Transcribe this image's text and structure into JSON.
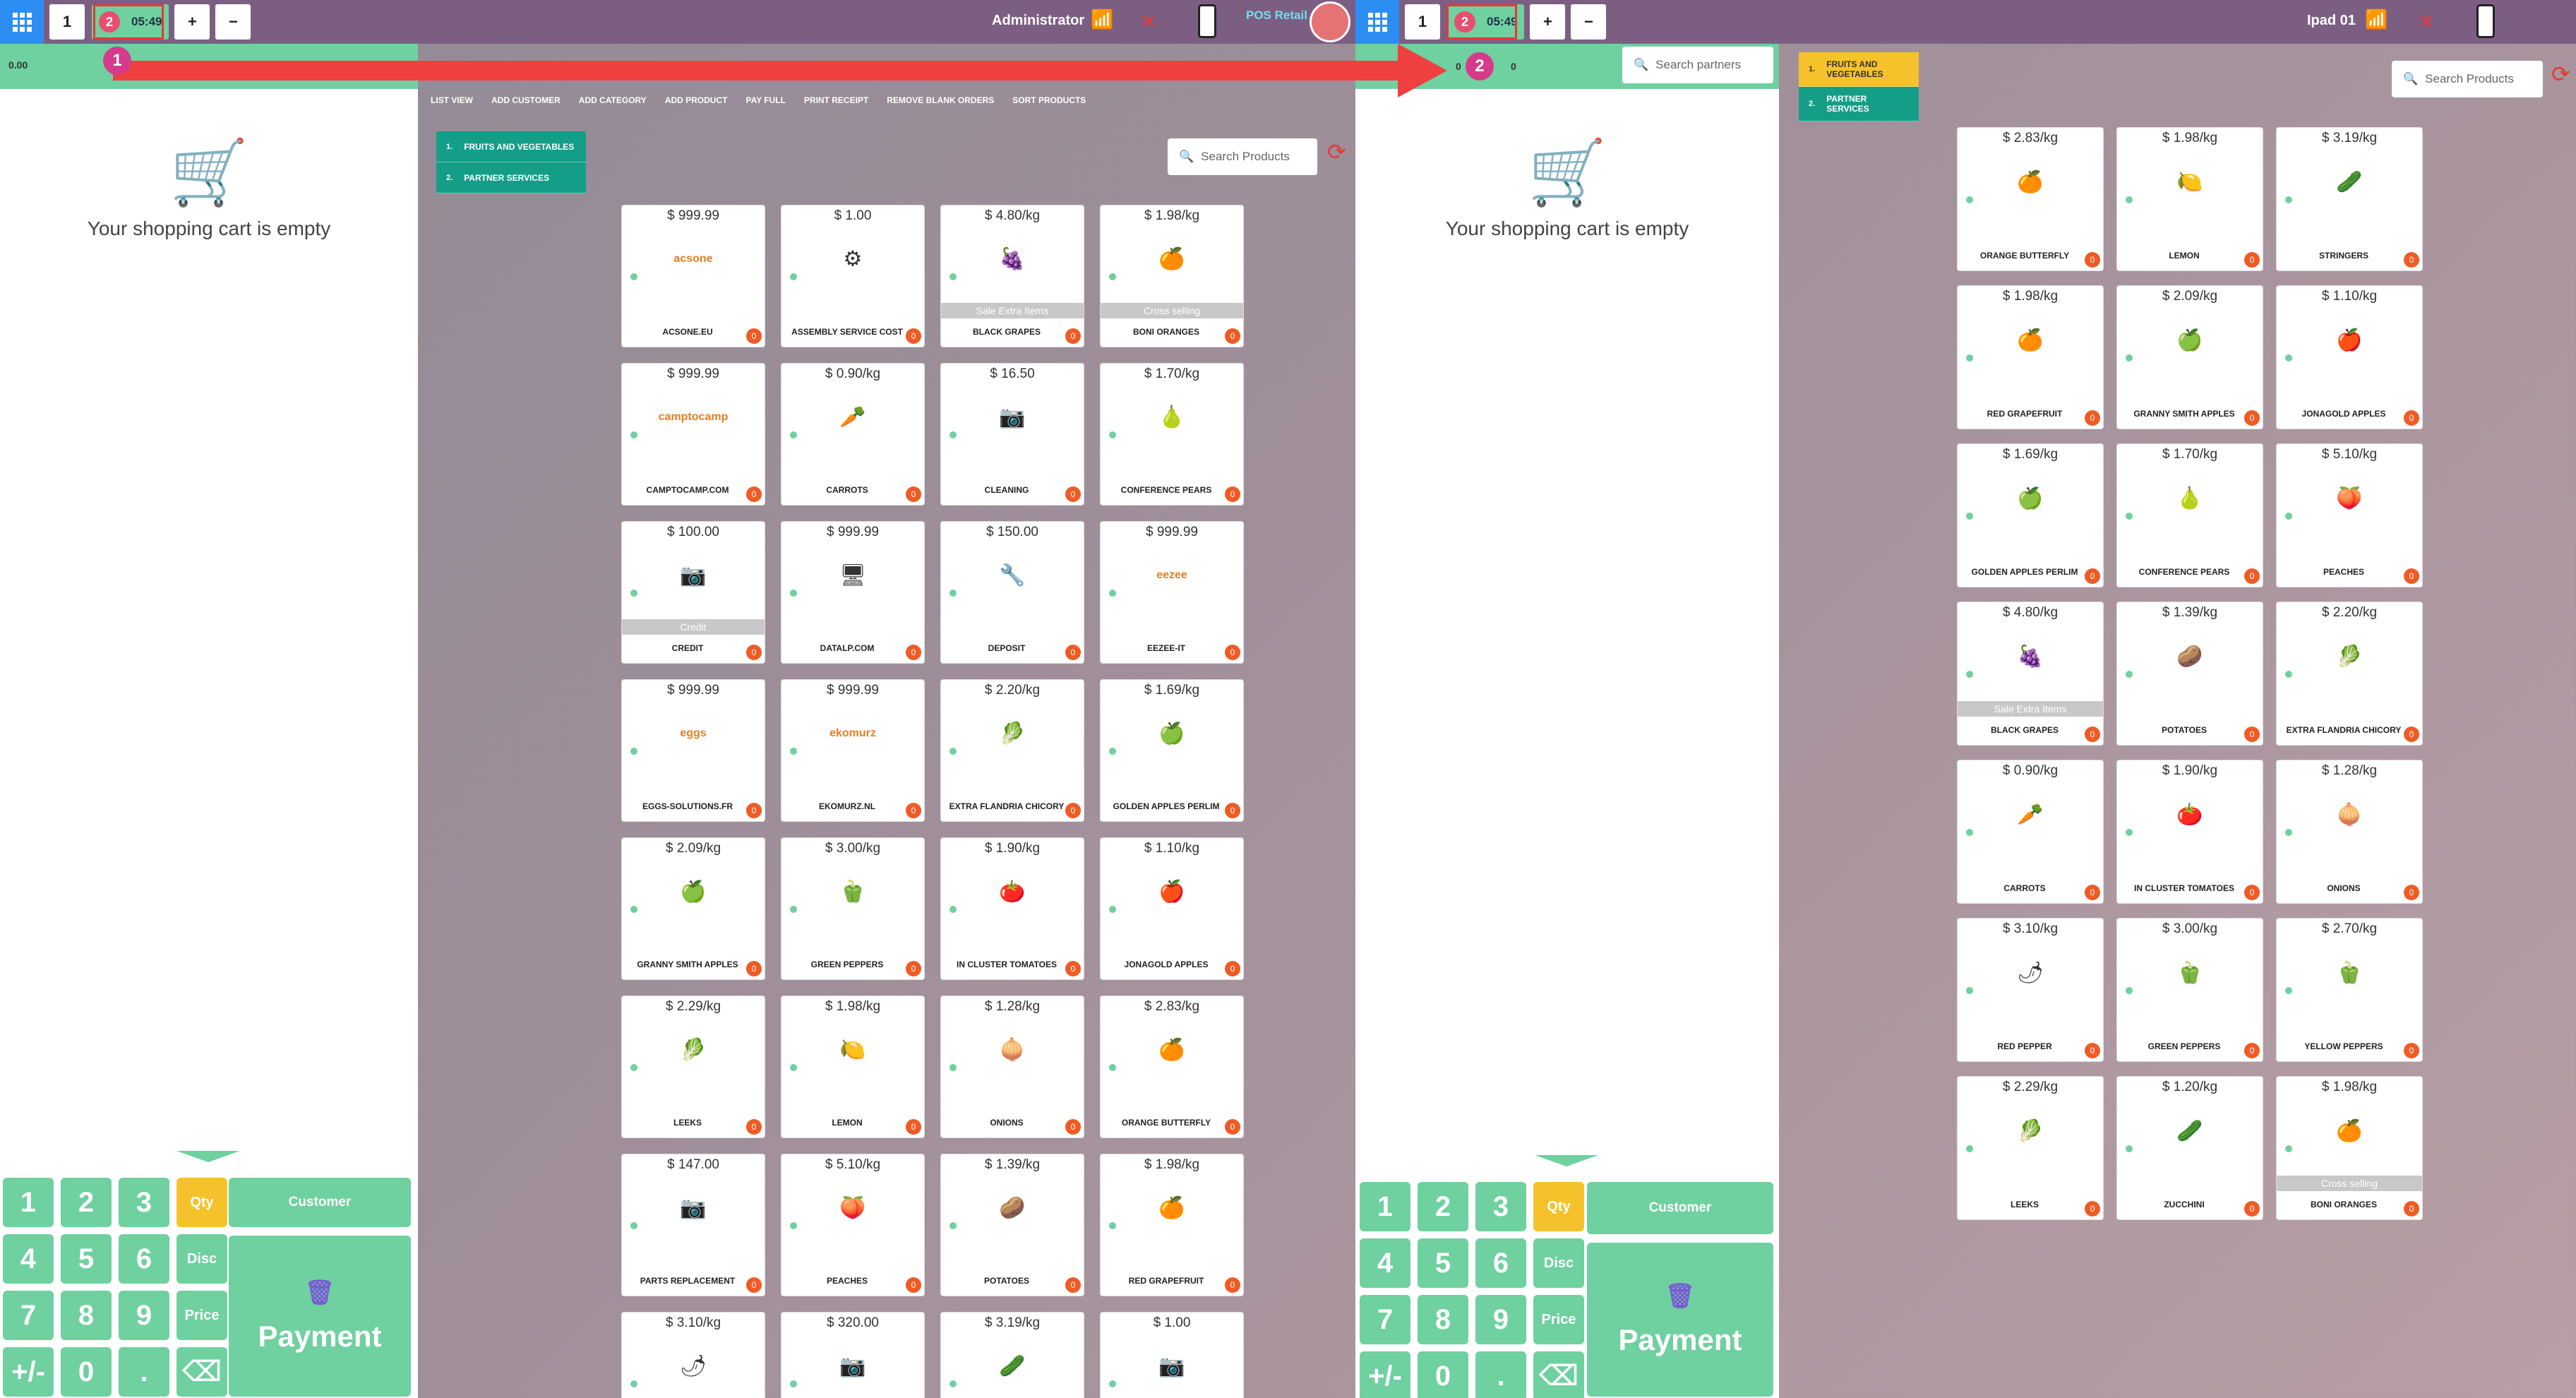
{
  "left_topbar": {
    "tab_number": "1",
    "order_number": "2",
    "order_time": "05:49",
    "plus_label": "+",
    "minus_label": "−",
    "user_label": "Administrator",
    "brand_label": "POS Retail"
  },
  "right_topbar": {
    "tab_number": "1",
    "order_number": "2",
    "order_time": "05:49",
    "plus_label": "+",
    "minus_label": "−",
    "device_label": "Ipad 01"
  },
  "left_panel": {
    "strip_value": "0.00",
    "cart_empty_text": "Your shopping cart is empty",
    "customer_label": "Customer",
    "payment_label": "Payment"
  },
  "right_panel": {
    "strip_value_a": "0",
    "strip_value_b": "0",
    "search_placeholder": "Search partners",
    "cart_empty_text": "Your shopping cart is empty",
    "customer_label": "Customer",
    "payment_label": "Payment"
  },
  "numpad_keys": [
    "1",
    "2",
    "3",
    "Qty",
    "4",
    "5",
    "6",
    "Disc",
    "7",
    "8",
    "9",
    "Price",
    "+/-",
    "0",
    ".",
    "⌫"
  ],
  "toolbar": [
    "LIST VIEW",
    "ADD CUSTOMER",
    "ADD CATEGORY",
    "ADD PRODUCT",
    "PAY FULL",
    "PRINT RECEIPT",
    "REMOVE BLANK ORDERS",
    "SORT PRODUCTS"
  ],
  "categories_left": [
    {
      "idx": "1.",
      "label": "FRUITS AND VEGETABLES"
    },
    {
      "idx": "2.",
      "label": "PARTNER SERVICES"
    }
  ],
  "categories_right": [
    {
      "idx": "1.",
      "label": "FRUITS AND VEGETABLES"
    },
    {
      "idx": "2.",
      "label": "PARTNER SERVICES"
    }
  ],
  "search_products_placeholder": "Search Products",
  "annotations": {
    "marker_1": "1",
    "marker_2": "2"
  },
  "products_left": [
    {
      "price": "$ 999.99",
      "name": "ACSONE.EU",
      "badge": "0",
      "thumb": "acsone"
    },
    {
      "price": "$ 1.00",
      "name": "ASSEMBLY SERVICE COST",
      "badge": "0",
      "thumb": "⚙"
    },
    {
      "price": "$ 4.80/kg",
      "name": "BLACK GRAPES",
      "badge": "0",
      "thumb": "🍇",
      "promo": "Sale Extra Items"
    },
    {
      "price": "$ 1.98/kg",
      "name": "BONI ORANGES",
      "badge": "0",
      "thumb": "🍊",
      "promo": "Cross selling"
    },
    {
      "price": "$ 999.99",
      "name": "CAMPTOCAMP.COM",
      "badge": "0",
      "thumb": "camptocamp"
    },
    {
      "price": "$ 0.90/kg",
      "name": "CARROTS",
      "badge": "0",
      "thumb": "🥕"
    },
    {
      "price": "$ 16.50",
      "name": "CLEANING",
      "badge": "0",
      "thumb": "📷"
    },
    {
      "price": "$ 1.70/kg",
      "name": "CONFERENCE PEARS",
      "badge": "0",
      "thumb": "🍐"
    },
    {
      "price": "$ 100.00",
      "name": "CREDIT",
      "badge": "0",
      "thumb": "📷",
      "promo": "Credit"
    },
    {
      "price": "$ 999.99",
      "name": "DATALP.COM",
      "badge": "0",
      "thumb": "🖥"
    },
    {
      "price": "$ 150.00",
      "name": "DEPOSIT",
      "badge": "0",
      "thumb": "🔧"
    },
    {
      "price": "$ 999.99",
      "name": "EEZEE-IT",
      "badge": "0",
      "thumb": "eezee"
    },
    {
      "price": "$ 999.99",
      "name": "EGGS-SOLUTIONS.FR",
      "badge": "0",
      "thumb": "eggs"
    },
    {
      "price": "$ 999.99",
      "name": "EKOMURZ.NL",
      "badge": "0",
      "thumb": "ekomurz"
    },
    {
      "price": "$ 2.20/kg",
      "name": "EXTRA FLANDRIA CHICORY",
      "badge": "0",
      "thumb": "🥬"
    },
    {
      "price": "$ 1.69/kg",
      "name": "GOLDEN APPLES PERLIM",
      "badge": "0",
      "thumb": "🍏"
    },
    {
      "price": "$ 2.09/kg",
      "name": "GRANNY SMITH APPLES",
      "badge": "0",
      "thumb": "🍏"
    },
    {
      "price": "$ 3.00/kg",
      "name": "GREEN PEPPERS",
      "badge": "0",
      "thumb": "🫑"
    },
    {
      "price": "$ 1.90/kg",
      "name": "IN CLUSTER TOMATOES",
      "badge": "0",
      "thumb": "🍅"
    },
    {
      "price": "$ 1.10/kg",
      "name": "JONAGOLD APPLES",
      "badge": "0",
      "thumb": "🍎"
    },
    {
      "price": "$ 2.29/kg",
      "name": "LEEKS",
      "badge": "0",
      "thumb": "🥬"
    },
    {
      "price": "$ 1.98/kg",
      "name": "LEMON",
      "badge": "0",
      "thumb": "🍋"
    },
    {
      "price": "$ 1.28/kg",
      "name": "ONIONS",
      "badge": "0",
      "thumb": "🧅"
    },
    {
      "price": "$ 2.83/kg",
      "name": "ORANGE BUTTERFLY",
      "badge": "0",
      "thumb": "🍊"
    },
    {
      "price": "$ 147.00",
      "name": "PARTS REPLACEMENT",
      "badge": "0",
      "thumb": "📷"
    },
    {
      "price": "$ 5.10/kg",
      "name": "PEACHES",
      "badge": "0",
      "thumb": "🍑"
    },
    {
      "price": "$ 1.39/kg",
      "name": "POTATOES",
      "badge": "0",
      "thumb": "🥔"
    },
    {
      "price": "$ 1.98/kg",
      "name": "RED GRAPEFRUIT",
      "badge": "0",
      "thumb": "🍊"
    },
    {
      "price": "$ 3.10/kg",
      "name": "",
      "badge": "",
      "thumb": "🌶"
    },
    {
      "price": "$ 320.00",
      "name": "",
      "badge": "",
      "thumb": "📷"
    },
    {
      "price": "$ 3.19/kg",
      "name": "",
      "badge": "",
      "thumb": "🥒"
    },
    {
      "price": "$ 1.00",
      "name": "",
      "badge": "",
      "thumb": "📷"
    }
  ],
  "products_right": [
    {
      "price": "$ 2.83/kg",
      "name": "ORANGE BUTTERFLY",
      "badge": "0",
      "thumb": "🍊"
    },
    {
      "price": "$ 1.98/kg",
      "name": "LEMON",
      "badge": "0",
      "thumb": "🍋"
    },
    {
      "price": "$ 3.19/kg",
      "name": "STRINGERS",
      "badge": "0",
      "thumb": "🥒"
    },
    {
      "price": "$ 1.98/kg",
      "name": "RED GRAPEFRUIT",
      "badge": "0",
      "thumb": "🍊"
    },
    {
      "price": "$ 2.09/kg",
      "name": "GRANNY SMITH APPLES",
      "badge": "0",
      "thumb": "🍏"
    },
    {
      "price": "$ 1.10/kg",
      "name": "JONAGOLD APPLES",
      "badge": "0",
      "thumb": "🍎"
    },
    {
      "price": "$ 1.69/kg",
      "name": "GOLDEN APPLES PERLIM",
      "badge": "0",
      "thumb": "🍏"
    },
    {
      "price": "$ 1.70/kg",
      "name": "CONFERENCE PEARS",
      "badge": "0",
      "thumb": "🍐"
    },
    {
      "price": "$ 5.10/kg",
      "name": "PEACHES",
      "badge": "0",
      "thumb": "🍑"
    },
    {
      "price": "$ 4.80/kg",
      "name": "BLACK GRAPES",
      "badge": "0",
      "thumb": "🍇",
      "promo": "Sale Extra Items"
    },
    {
      "price": "$ 1.39/kg",
      "name": "POTATOES",
      "badge": "0",
      "thumb": "🥔"
    },
    {
      "price": "$ 2.20/kg",
      "name": "EXTRA FLANDRIA CHICORY",
      "badge": "0",
      "thumb": "🥬"
    },
    {
      "price": "$ 0.90/kg",
      "name": "CARROTS",
      "badge": "0",
      "thumb": "🥕"
    },
    {
      "price": "$ 1.90/kg",
      "name": "IN CLUSTER TOMATOES",
      "badge": "0",
      "thumb": "🍅"
    },
    {
      "price": "$ 1.28/kg",
      "name": "ONIONS",
      "badge": "0",
      "thumb": "🧅"
    },
    {
      "price": "$ 3.10/kg",
      "name": "RED PEPPER",
      "badge": "0",
      "thumb": "🌶"
    },
    {
      "price": "$ 3.00/kg",
      "name": "GREEN PEPPERS",
      "badge": "0",
      "thumb": "🫑"
    },
    {
      "price": "$ 2.70/kg",
      "name": "YELLOW PEPPERS",
      "badge": "0",
      "thumb": "🫑"
    },
    {
      "price": "$ 2.29/kg",
      "name": "LEEKS",
      "badge": "0",
      "thumb": "🥬"
    },
    {
      "price": "$ 1.20/kg",
      "name": "ZUCCHINI",
      "badge": "0",
      "thumb": "🥒"
    },
    {
      "price": "$ 1.98/kg",
      "name": "BONI ORANGES",
      "badge": "0",
      "thumb": "🍊",
      "promo": "Cross selling"
    }
  ]
}
